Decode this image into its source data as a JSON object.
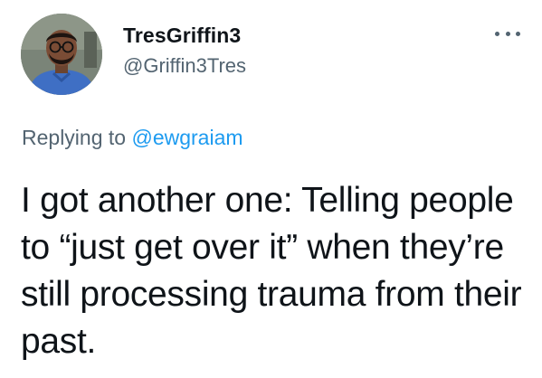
{
  "tweet": {
    "author": {
      "display_name": "TresGriffin3",
      "handle": "@Griffin3Tres",
      "avatar_icon": "profile-photo"
    },
    "more_icon": "more-options-icon",
    "reply": {
      "prefix": "Replying to",
      "mention": "@ewgraiam"
    },
    "text": "I got another one: Telling people to “just get over it” when they’re still processing trauma from their past."
  },
  "colors": {
    "text_primary": "#0f1419",
    "text_secondary": "#536471",
    "link": "#1d9bf0"
  }
}
